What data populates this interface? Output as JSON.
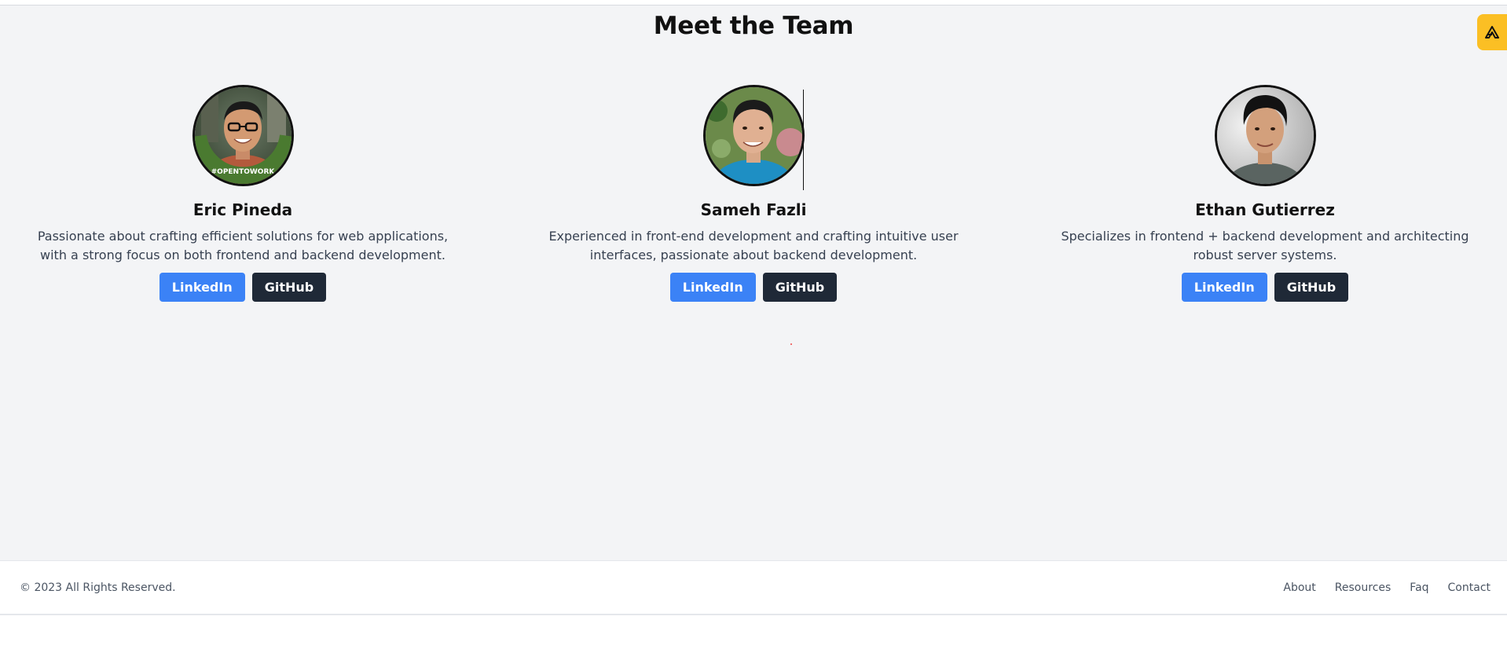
{
  "page": {
    "heading": "Meet the Team"
  },
  "team": [
    {
      "name": "Eric Pineda",
      "description": "Passionate about crafting efficient solutions for web applications, with a strong focus on both frontend and backend development.",
      "linkedin_label": "LinkedIn",
      "github_label": "GitHub",
      "avatar_badge": "#OPENTOWORK"
    },
    {
      "name": "Sameh Fazli",
      "description": "Experienced in front-end development and crafting intuitive user interfaces, passionate about backend development.",
      "linkedin_label": "LinkedIn",
      "github_label": "GitHub"
    },
    {
      "name": "Ethan Gutierrez",
      "description": "Specializes in frontend + backend development and architecting robust server systems.",
      "linkedin_label": "LinkedIn",
      "github_label": "GitHub"
    }
  ],
  "footer": {
    "copyright": "© 2023 All Rights Reserved.",
    "links": [
      "About",
      "Resources",
      "Faq",
      "Contact"
    ]
  },
  "colors": {
    "background": "#f3f4f6",
    "linkedin": "#3b82f6",
    "github": "#1f2937",
    "floating_button": "#fbbf24"
  },
  "icons": {
    "floating_button": "brand-logo-icon"
  }
}
